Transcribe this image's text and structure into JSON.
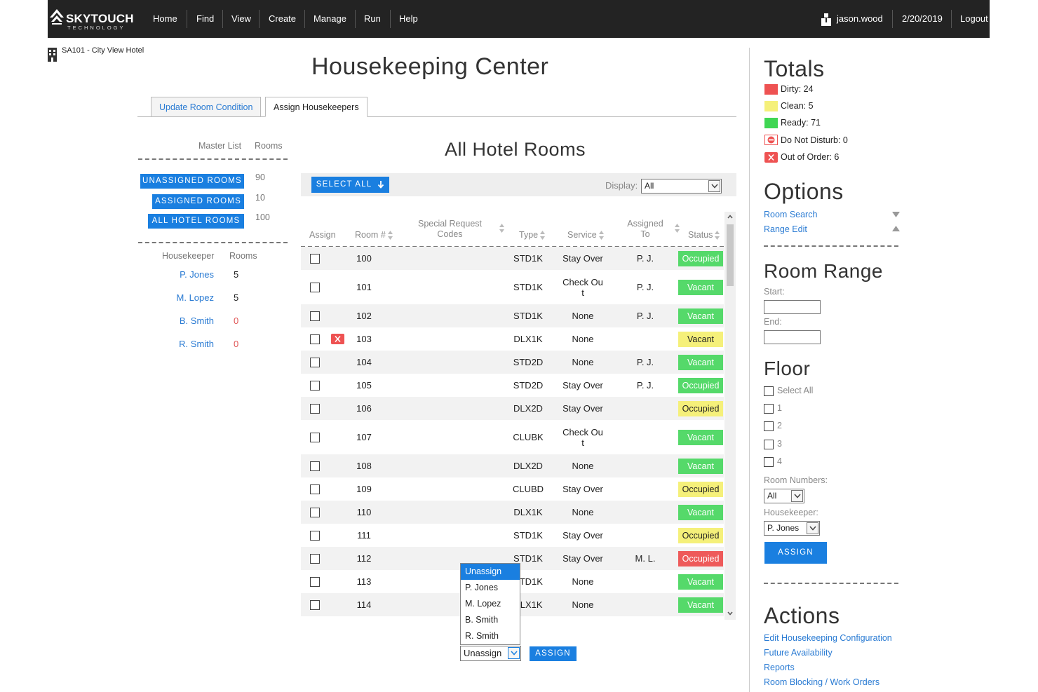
{
  "nav": {
    "brand": "SKYTOUCH",
    "brand_sub": "TECHNOLOGY",
    "items": [
      "Home",
      "Find",
      "View",
      "Create",
      "Manage",
      "Run",
      "Help"
    ],
    "user": "jason.wood",
    "date": "2/20/2019",
    "logout": "Logout"
  },
  "hotel": {
    "name": "SA101 - City View Hotel"
  },
  "page": {
    "title": "Housekeeping Center"
  },
  "tabs": {
    "update": "Update Room Condition",
    "assign": "Assign Housekeepers"
  },
  "left": {
    "master_list_label": "Master List",
    "rooms_label": "Rooms",
    "buttons": [
      {
        "label": "UNASSIGNED ROOMS",
        "count": "90"
      },
      {
        "label": "ASSIGNED ROOMS",
        "count": "10"
      },
      {
        "label": "ALL HOTEL ROOMS",
        "count": "100"
      }
    ],
    "housekeeper_label": "Housekeeper",
    "hk_rooms_label": "Rooms",
    "housekeepers": [
      {
        "name": "P. Jones",
        "count": "5"
      },
      {
        "name": "M. Lopez",
        "count": "5"
      },
      {
        "name": "B. Smith",
        "count": "0"
      },
      {
        "name": "R. Smith",
        "count": "0"
      }
    ]
  },
  "main": {
    "title": "All Hotel Rooms",
    "select_all": "SELECT ALL",
    "display_label": "Display:",
    "display_value": "All",
    "columns": {
      "assign": "Assign",
      "room": "Room #",
      "special1": "Special Request",
      "special2": "Codes",
      "type": "Type",
      "service": "Service",
      "assigned1": "Assigned",
      "assigned2": "To",
      "status": "Status"
    },
    "rows": [
      {
        "room": "100",
        "type": "STD1K",
        "service": "Stay Over",
        "service2": "",
        "assigned": "P. J.",
        "status": "Occupied",
        "style": "st-occ-green",
        "ooo": false
      },
      {
        "room": "101",
        "type": "STD1K",
        "service": "Check Ou",
        "service2": "t",
        "assigned": "P. J.",
        "status": "Vacant",
        "style": "st-vac-green",
        "ooo": false
      },
      {
        "room": "102",
        "type": "STD1K",
        "service": "None",
        "service2": "",
        "assigned": "P. J.",
        "status": "Vacant",
        "style": "st-vac-green",
        "ooo": false
      },
      {
        "room": "103",
        "type": "DLX1K",
        "service": "None",
        "service2": "",
        "assigned": "",
        "status": "Vacant",
        "style": "st-vac-yellow",
        "ooo": true
      },
      {
        "room": "104",
        "type": "STD2D",
        "service": "None",
        "service2": "",
        "assigned": "P. J.",
        "status": "Vacant",
        "style": "st-vac-green",
        "ooo": false
      },
      {
        "room": "105",
        "type": "STD2D",
        "service": "Stay Over",
        "service2": "",
        "assigned": "P. J.",
        "status": "Occupied",
        "style": "st-occ-green",
        "ooo": false
      },
      {
        "room": "106",
        "type": "DLX2D",
        "service": "Stay Over",
        "service2": "",
        "assigned": "",
        "status": "Occupied",
        "style": "st-occ-yellow",
        "ooo": false
      },
      {
        "room": "107",
        "type": "CLUBK",
        "service": "Check Ou",
        "service2": "t",
        "assigned": "",
        "status": "Vacant",
        "style": "st-vac-green",
        "ooo": false
      },
      {
        "room": "108",
        "type": "DLX2D",
        "service": "None",
        "service2": "",
        "assigned": "",
        "status": "Vacant",
        "style": "st-vac-green",
        "ooo": false
      },
      {
        "room": "109",
        "type": "CLUBD",
        "service": "Stay Over",
        "service2": "",
        "assigned": "",
        "status": "Occupied",
        "style": "st-occ-yellow",
        "ooo": false
      },
      {
        "room": "110",
        "type": "DLX1K",
        "service": "None",
        "service2": "",
        "assigned": "",
        "status": "Vacant",
        "style": "st-vac-green",
        "ooo": false
      },
      {
        "room": "111",
        "type": "STD1K",
        "service": "Stay Over",
        "service2": "",
        "assigned": "",
        "status": "Occupied",
        "style": "st-occ-yellow",
        "ooo": false
      },
      {
        "room": "112",
        "type": "STD1K",
        "service": "Stay Over",
        "service2": "",
        "assigned": "M. L.",
        "status": "Occupied",
        "style": "st-occ-red",
        "ooo": false
      },
      {
        "room": "113",
        "type": "STD1K",
        "service": "None",
        "service2": "",
        "assigned": "",
        "status": "Vacant",
        "style": "st-vac-green",
        "ooo": false
      },
      {
        "room": "114",
        "type": "DLX1K",
        "service": "None",
        "service2": "",
        "assigned": "",
        "status": "Vacant",
        "style": "st-vac-green",
        "ooo": false
      }
    ],
    "dropdown_options": [
      "Unassign",
      "P. Jones",
      "M. Lopez",
      "B. Smith",
      "R. Smith"
    ],
    "dropdown_value": "Unassign",
    "assign_button": "ASSIGN"
  },
  "right": {
    "totals_title": "Totals",
    "totals": [
      {
        "label": "Dirty: 24",
        "color": "#ee5252"
      },
      {
        "label": "Clean: 5",
        "color": "#f5f07a"
      },
      {
        "label": "Ready: 71",
        "color": "#3fd653"
      },
      {
        "label": "Do Not Disturb: 0",
        "color": "dnd"
      },
      {
        "label": "Out of Order: 6",
        "color": "ooo"
      }
    ],
    "options_title": "Options",
    "room_search": "Room Search",
    "range_edit": "Range Edit",
    "room_range_title": "Room Range",
    "start_label": "Start:",
    "end_label": "End:",
    "floor_title": "Floor",
    "floor_items": [
      "Select All",
      "1",
      "2",
      "3",
      "4"
    ],
    "room_numbers_label": "Room Numbers:",
    "room_numbers_value": "All",
    "housekeeper_label": "Housekeeper:",
    "housekeeper_value": "P. Jones",
    "assign_button": "ASSIGN",
    "actions_title": "Actions",
    "actions": [
      "Edit Housekeeping Configuration",
      "Future Availability",
      "Reports",
      "Room Blocking / Work Orders"
    ]
  }
}
